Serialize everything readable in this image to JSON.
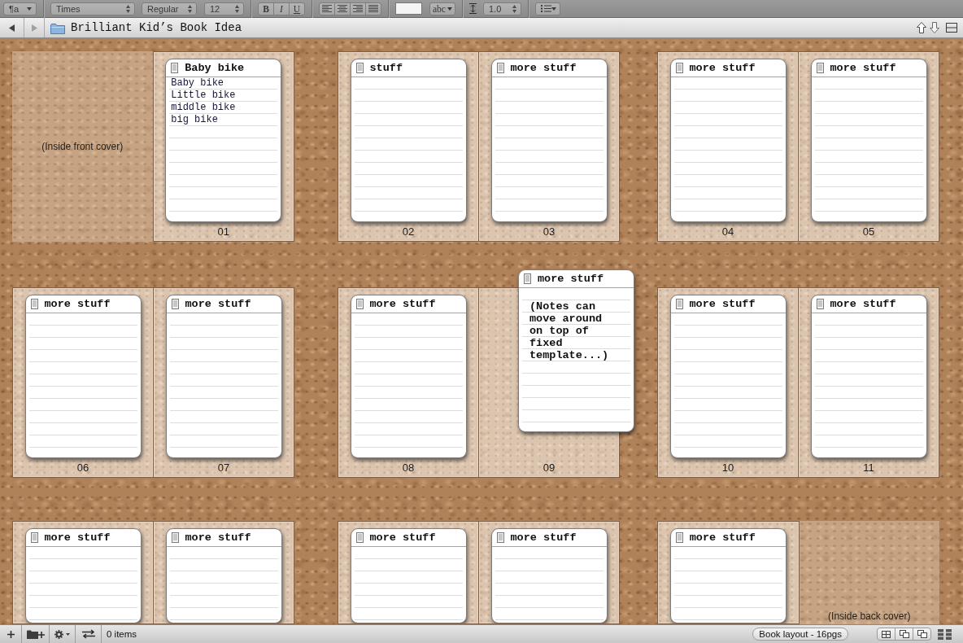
{
  "format_bar": {
    "disabled": true,
    "paragraph_style": "¶a",
    "font_family": "Times",
    "font_style": "Regular",
    "font_size": "12",
    "bold": "B",
    "italic": "I",
    "underline": "U",
    "highlight": "abc",
    "line_spacing": "1.0"
  },
  "header": {
    "back": {
      "disabled": false
    },
    "forward": {
      "disabled": true
    },
    "title": "Brilliant Kid’s Book Idea"
  },
  "corkboard": {
    "rows": [
      {
        "spreads": [
          {
            "pages": [
              {
                "kind": "cover",
                "label": "(Inside front cover)"
              },
              {
                "kind": "page",
                "number": "01",
                "card": {
                  "title": "Baby bike",
                  "lines": [
                    "Baby bike",
                    "Little bike",
                    "middle bike",
                    "big bike"
                  ]
                }
              }
            ]
          },
          {
            "pages": [
              {
                "kind": "page",
                "number": "02",
                "card": {
                  "title": "stuff"
                }
              },
              {
                "kind": "page",
                "number": "03",
                "card": {
                  "title": "more stuff"
                }
              }
            ]
          },
          {
            "pages": [
              {
                "kind": "page",
                "number": "04",
                "card": {
                  "title": "more stuff"
                }
              },
              {
                "kind": "page",
                "number": "05",
                "card": {
                  "title": "more stuff"
                }
              }
            ]
          }
        ]
      },
      {
        "spreads": [
          {
            "pages": [
              {
                "kind": "page",
                "number": "06",
                "card": {
                  "title": "more stuff"
                }
              },
              {
                "kind": "page",
                "number": "07",
                "card": {
                  "title": "more stuff"
                }
              }
            ]
          },
          {
            "pages": [
              {
                "kind": "page",
                "number": "08",
                "card": {
                  "title": "more stuff"
                }
              },
              {
                "kind": "page",
                "number": "09"
              }
            ]
          },
          {
            "pages": [
              {
                "kind": "page",
                "number": "10",
                "card": {
                  "title": "more stuff"
                }
              },
              {
                "kind": "page",
                "number": "11",
                "card": {
                  "title": "more stuff"
                }
              }
            ]
          }
        ]
      },
      {
        "spreads": [
          {
            "pages": [
              {
                "kind": "page",
                "card": {
                  "title": "more stuff"
                }
              },
              {
                "kind": "page",
                "card": {
                  "title": "more stuff"
                }
              }
            ]
          },
          {
            "pages": [
              {
                "kind": "page",
                "card": {
                  "title": "more stuff"
                }
              },
              {
                "kind": "page",
                "card": {
                  "title": "more stuff"
                }
              }
            ]
          },
          {
            "pages": [
              {
                "kind": "page",
                "card": {
                  "title": "more stuff"
                }
              },
              {
                "kind": "cover",
                "label": "(Inside back cover)"
              }
            ]
          }
        ]
      }
    ],
    "loose_cards": [
      {
        "title": "more stuff",
        "text": "(Notes can move around on top of fixed template...)"
      }
    ]
  },
  "status_bar": {
    "item_count": "0 items",
    "layout": "Book layout - 16pgs"
  }
}
